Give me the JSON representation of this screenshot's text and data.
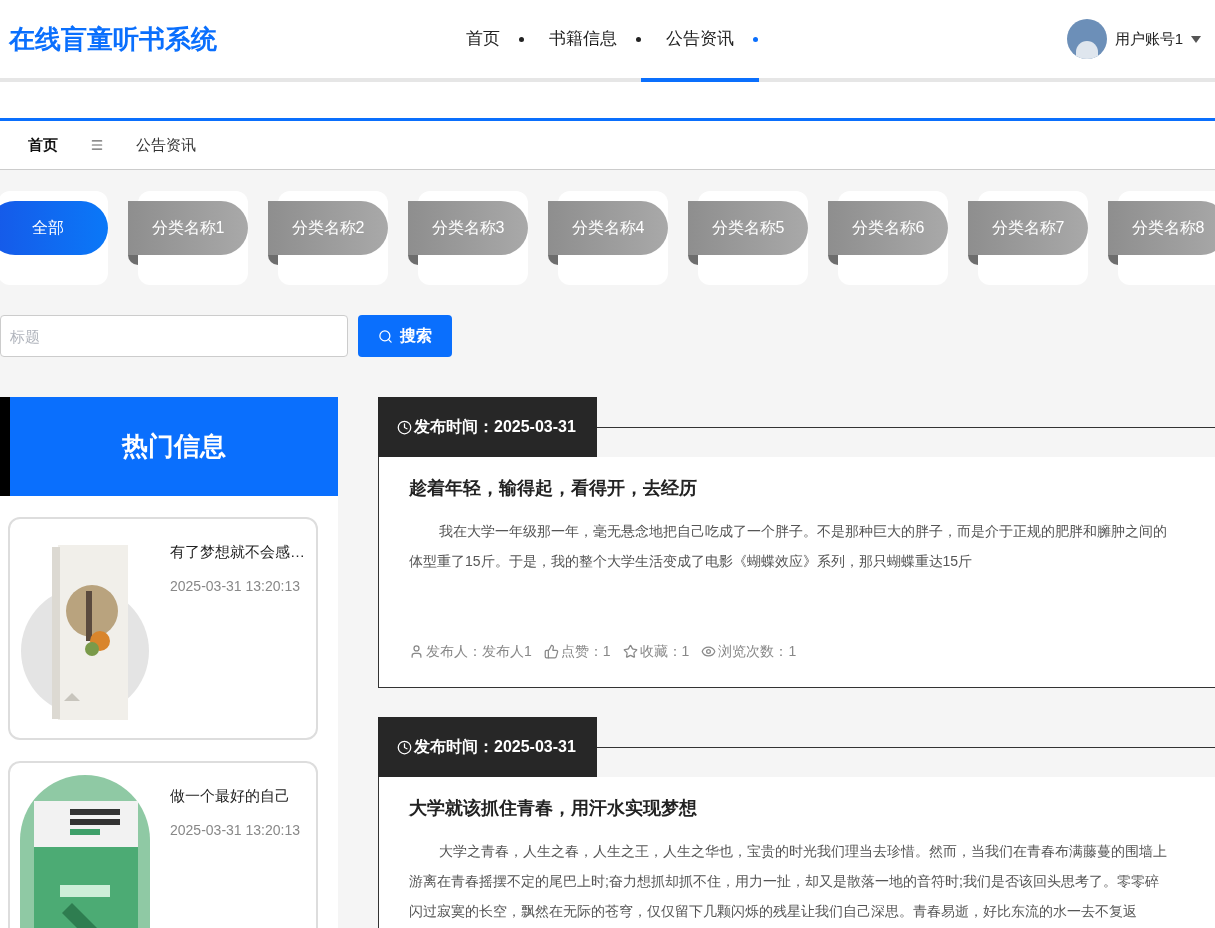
{
  "site_title": "在线盲童听书系统",
  "nav": [
    {
      "label": "首页",
      "selected": false
    },
    {
      "label": "书籍信息",
      "selected": false
    },
    {
      "label": "公告资讯",
      "selected": true
    }
  ],
  "user": {
    "name": "用户账号1"
  },
  "breadcrumb": {
    "home": "首页",
    "current": "公告资讯"
  },
  "categories": [
    {
      "label": "全部",
      "selected": true
    },
    {
      "label": "分类名称1",
      "selected": false
    },
    {
      "label": "分类名称2",
      "selected": false
    },
    {
      "label": "分类名称3",
      "selected": false
    },
    {
      "label": "分类名称4",
      "selected": false
    },
    {
      "label": "分类名称5",
      "selected": false
    },
    {
      "label": "分类名称6",
      "selected": false
    },
    {
      "label": "分类名称7",
      "selected": false
    },
    {
      "label": "分类名称8",
      "selected": false
    }
  ],
  "search": {
    "placeholder": "标题",
    "button": "搜索"
  },
  "hot": {
    "title": "热门信息",
    "items": [
      {
        "title": "有了梦想就不会感…",
        "time": "2025-03-31 13:20:13"
      },
      {
        "title": "做一个最好的自己",
        "time": "2025-03-31 13:20:13"
      }
    ]
  },
  "articles": [
    {
      "date_label": "发布时间：2025-03-31",
      "title": "趁着年轻，输得起，看得开，去经历",
      "lines": [
        "我在大学一年级那一年，毫无悬念地把自己吃成了一个胖子。不是那种巨大的胖子，而是介于正规的肥胖和臃肿之间的",
        "体型重了15斤。于是，我的整个大学生活变成了电影《蝴蝶效应》系列，那只蝴蝶重达15斤"
      ],
      "meta": [
        {
          "kind": "user",
          "text": "发布人：发布人1"
        },
        {
          "kind": "like",
          "text": "点赞：1"
        },
        {
          "kind": "star",
          "text": "收藏：1"
        },
        {
          "kind": "view",
          "text": "浏览次数：1"
        }
      ]
    },
    {
      "date_label": "发布时间：2025-03-31",
      "title": "大学就该抓住青春，用汗水实现梦想",
      "lines": [
        "大学之青春，人生之春，人生之王，人生之华也，宝贵的时光我们理当去珍惜。然而，当我们在青春布满藤蔓的围墙上",
        "游离在青春摇摆不定的尾巴上时;奋力想抓却抓不住，用力一扯，却又是散落一地的音符时;我们是否该回头思考了。零零碎",
        "闪过寂寞的长空，飘然在无际的苍穹，仅仅留下几颗闪烁的残星让我们自己深思。青春易逝，好比东流的水一去不复返"
      ]
    }
  ]
}
